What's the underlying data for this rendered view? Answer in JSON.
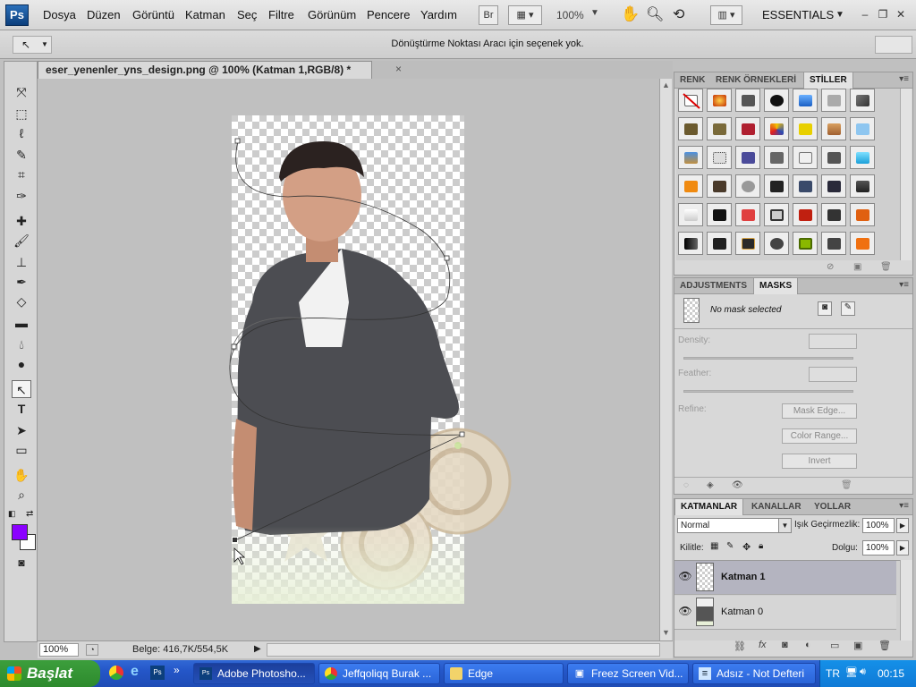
{
  "app": {
    "logo": "Ps"
  },
  "menu": [
    "Dosya",
    "Düzen",
    "Görüntü",
    "Katman",
    "Seç",
    "Filtre",
    "Görünüm",
    "Pencere",
    "Yardım"
  ],
  "menubar_right": {
    "bridge": "Br",
    "zoom": "100%",
    "workspace": "ESSENTIALS"
  },
  "options": {
    "message": "Dönüştürme Noktası Aracı için seçenek yok."
  },
  "document": {
    "tab_title": "eser_yenenler_yns_design.png @ 100% (Katman 1,RGB/8) *",
    "close": "×",
    "zoom": "100%",
    "info": "Belge: 416,7K/554,5K"
  },
  "colors": {
    "foreground": "#8b00ff",
    "background": "#ffffff"
  },
  "panels": {
    "swatches_tabs": [
      "RENK",
      "RENK ÖRNEKLERİ",
      "STİLLER"
    ],
    "adjust_tabs": [
      "ADJUSTMENTS",
      "MASKS"
    ],
    "mask_status": "No mask selected",
    "density_label": "Density:",
    "feather_label": "Feather:",
    "refine_label": "Refine:",
    "mask_edge": "Mask Edge...",
    "color_range": "Color Range...",
    "invert": "Invert",
    "layers_tabs": [
      "KATMANLAR",
      "KANALLAR",
      "YOLLAR"
    ],
    "blend_mode": "Normal",
    "opacity_label": "Işık Geçirmezlik:",
    "opacity": "100%",
    "lock_label": "Kilitle:",
    "fill_label": "Dolgu:",
    "fill": "100%",
    "layers": [
      {
        "name": "Katman 1",
        "selected": true
      },
      {
        "name": "Katman 0",
        "selected": false
      }
    ]
  },
  "taskbar": {
    "start": "Başlat",
    "tasks": [
      "Adobe Photosho...",
      "Jeffqoliqq Burak ...",
      "Edge",
      "Freez Screen Vid...",
      "Adsız - Not Defteri"
    ],
    "lang": "TR",
    "time": "00:15"
  }
}
